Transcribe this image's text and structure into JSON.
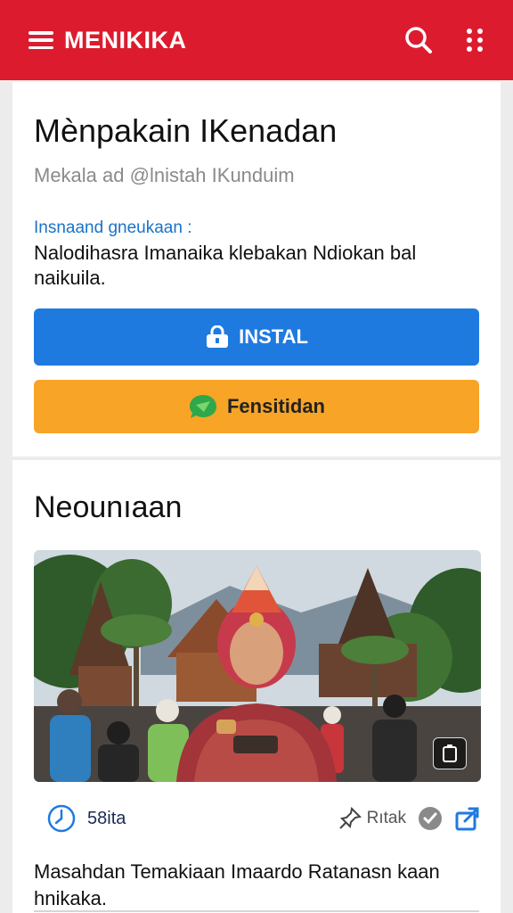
{
  "header": {
    "app_title": "MENIKIKA",
    "menu_icon": "hamburger-menu-icon",
    "search_icon": "search-icon",
    "more_icon": "more-dots-icon",
    "brand_color": "#dc1c2e"
  },
  "app_card": {
    "title": "Mènpakain IKenadan",
    "subtitle": "Mekala ad @lnistah IKunduim",
    "info_label": "Insnaand gneukaan :",
    "info_text": "Nalodihasra Imanaika klebakan Ndiokan bal naikuila.",
    "install_button": {
      "label": "INSTAL",
      "icon": "lock-icon",
      "color": "#1f7ae0"
    },
    "share_button": {
      "label": "Fensitidan",
      "icon": "chat-bubble-icon",
      "color": "#f7a427"
    }
  },
  "news_card": {
    "section_title": "Neounıaan",
    "photo_alt_icon": "phone-frame-icon",
    "time": "58ita",
    "time_icon": "clock-icon",
    "pin_label": "Rıtak",
    "pin_icon": "pin-icon",
    "check_icon": "check-circle-icon",
    "share_icon": "share-icon",
    "caption": "Masahdan Temakiaan Imaardo Ratanasn kaan hnikaka."
  }
}
